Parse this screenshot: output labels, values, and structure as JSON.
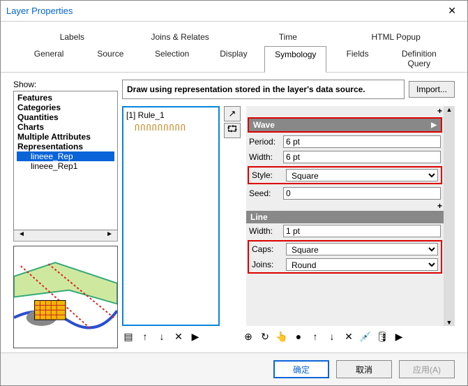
{
  "window": {
    "title": "Layer Properties",
    "close": "✕"
  },
  "tabs_row1": [
    {
      "label": "Labels"
    },
    {
      "label": "Joins & Relates"
    },
    {
      "label": "Time"
    },
    {
      "label": "HTML Popup"
    }
  ],
  "tabs_row2": [
    {
      "label": "General"
    },
    {
      "label": "Source"
    },
    {
      "label": "Selection"
    },
    {
      "label": "Display"
    },
    {
      "label": "Symbology",
      "active": true
    },
    {
      "label": "Fields"
    },
    {
      "label": "Definition Query"
    }
  ],
  "show": {
    "label": "Show:",
    "items": [
      {
        "label": "Features",
        "bold": true
      },
      {
        "label": "Categories",
        "bold": true
      },
      {
        "label": "Quantities",
        "bold": true
      },
      {
        "label": "Charts",
        "bold": true
      },
      {
        "label": "Multiple Attributes",
        "bold": true
      },
      {
        "label": "Representations",
        "bold": true
      },
      {
        "label": "lineee_Rep",
        "indent": 2,
        "selected": true
      },
      {
        "label": "lineee_Rep1",
        "indent": 2
      }
    ],
    "scroll_left": "◄",
    "scroll_right": "►"
  },
  "desc": "Draw using representation stored in the layer's data source.",
  "import_btn": "Import...",
  "rule": {
    "label": "[1] Rule_1",
    "wave": "ՈՈՈՈՈՈՈՈՈ"
  },
  "side_icons": {
    "arrow": "↗",
    "link": "⮔"
  },
  "props": {
    "plus": "+",
    "wave": {
      "header": "Wave",
      "arrow": "▶",
      "period_label": "Period:",
      "period": "6 pt",
      "width_label": "Width:",
      "width": "6 pt",
      "style_label": "Style:",
      "style": "Square",
      "seed_label": "Seed:",
      "seed": "0"
    },
    "line": {
      "header": "Line",
      "width_label": "Width:",
      "width": "1 pt",
      "caps_label": "Caps:",
      "caps": "Square",
      "joins_label": "Joins:",
      "joins": "Round"
    },
    "scroll_up": "▲",
    "scroll_down": "▼"
  },
  "rule_toolbar": {
    "tree": "▤",
    "up": "↑",
    "down": "↓",
    "del": "✕",
    "play": "▶"
  },
  "prop_toolbar": {
    "a": "⊕",
    "b": "↻",
    "c": "👆",
    "d": "●",
    "up": "↑",
    "down": "↓",
    "del": "✕",
    "picker": "💉",
    "db": "🛢",
    "play": "▶"
  },
  "footer": {
    "ok": "确定",
    "cancel": "取消",
    "apply": "应用(A)"
  }
}
